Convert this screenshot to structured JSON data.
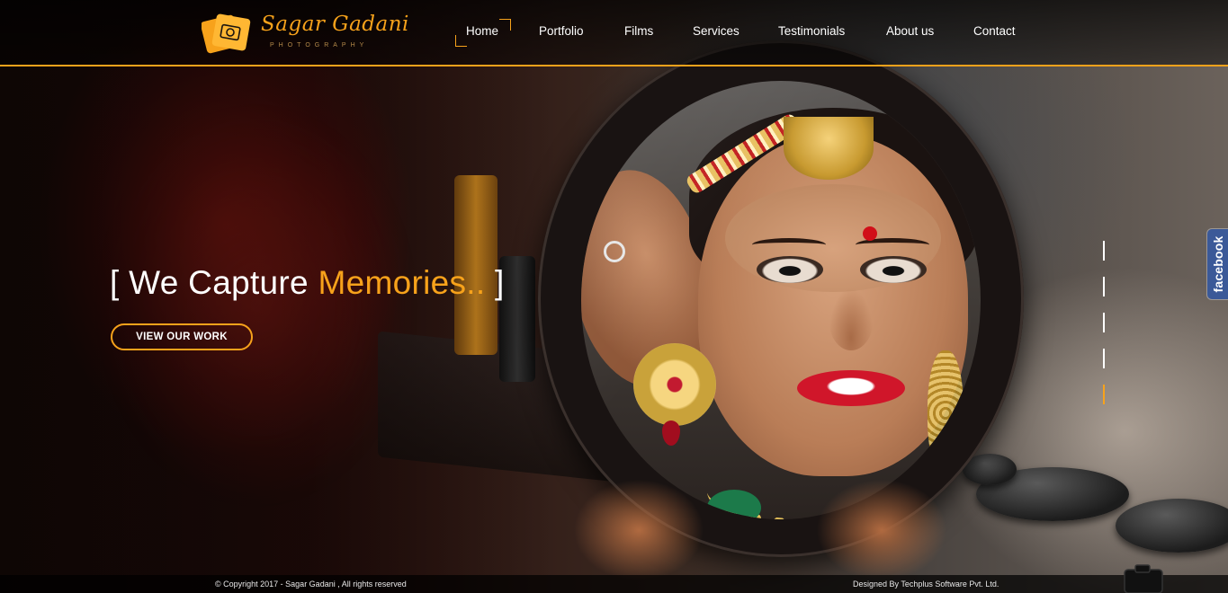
{
  "brand": {
    "name": "Sagar Gadani",
    "tagline": "PHOTOGRAPHY",
    "accent_color": "#f7a21b"
  },
  "nav": {
    "items": [
      {
        "label": "Home",
        "active": true
      },
      {
        "label": "Portfolio",
        "active": false
      },
      {
        "label": "Films",
        "active": false
      },
      {
        "label": "Services",
        "active": false
      },
      {
        "label": "Testimonials",
        "active": false
      },
      {
        "label": "About us",
        "active": false
      },
      {
        "label": "Contact",
        "active": false
      }
    ]
  },
  "hero": {
    "title_open": "[ We Capture ",
    "title_accent": "Memories..",
    "title_close": " ]",
    "cta_label": "VIEW OUR WORK",
    "background_image": "bride-in-mirror",
    "slides_total": 6,
    "slide_active": 6
  },
  "social": {
    "facebook_label": "facebook",
    "facebook_color": "#3b5998"
  },
  "footer": {
    "copyright": "© Copyright 2017 - Sagar Gadani , All rights reserved",
    "credit": "Designed By Techplus Software Pvt. Ltd."
  }
}
